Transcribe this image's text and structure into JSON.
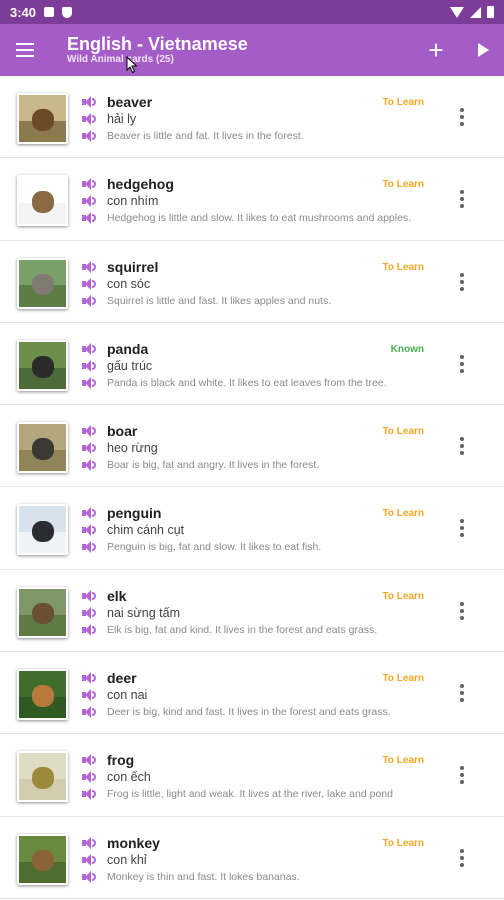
{
  "status_bar": {
    "time": "3:40"
  },
  "app_bar": {
    "title": "English - Vietnamese",
    "subtitle": "Wild Animal cards (25)",
    "add_label": "+"
  },
  "colors": {
    "accent": "#a45dc7",
    "to_learn": "#f5a623",
    "known": "#4caf50"
  },
  "cards": [
    {
      "word": "beaver",
      "translation": "hải ly",
      "sentence": "Beaver is little and fat. It lives in the forest.",
      "status": "To Learn",
      "thumb": "beaver-photo"
    },
    {
      "word": "hedgehog",
      "translation": "con nhím",
      "sentence": "Hedgehog is little and slow. It likes to eat mushrooms and apples.",
      "status": "To Learn",
      "thumb": "hedgehog-photo"
    },
    {
      "word": "squirrel",
      "translation": "con sóc",
      "sentence": "Squirrel is little and fast. It likes apples and nuts.",
      "status": "To Learn",
      "thumb": "squirrel-photo"
    },
    {
      "word": "panda",
      "translation": "gấu trúc",
      "sentence": "Panda is black and white. It likes to eat leaves from the tree.",
      "status": "Known",
      "thumb": "panda-photo"
    },
    {
      "word": "boar",
      "translation": "heo rừng",
      "sentence": "Boar is big, fat and angry. It lives in the forest.",
      "status": "To Learn",
      "thumb": "boar-photo"
    },
    {
      "word": "penguin",
      "translation": "chim cánh cụt",
      "sentence": "Penguin is big, fat and slow. It likes to eat fish.",
      "status": "To Learn",
      "thumb": "penguin-photo"
    },
    {
      "word": "elk",
      "translation": "nai sừng tấm",
      "sentence": "Elk is big, fat and kind. It lives in the forest and eats grass.",
      "status": "To Learn",
      "thumb": "elk-photo"
    },
    {
      "word": "deer",
      "translation": "con nai",
      "sentence": "Deer is big, kind and fast. It lives in the forest and eats grass.",
      "status": "To Learn",
      "thumb": "deer-photo"
    },
    {
      "word": "frog",
      "translation": "con ếch",
      "sentence": "Frog is little, light and weak. It lives at the river, lake and pond",
      "status": "To Learn",
      "thumb": "frog-photo"
    },
    {
      "word": "monkey",
      "translation": "con khỉ",
      "sentence": "Monkey is thin and fast. It lokes bananas.",
      "status": "To Learn",
      "thumb": "monkey-photo"
    }
  ]
}
